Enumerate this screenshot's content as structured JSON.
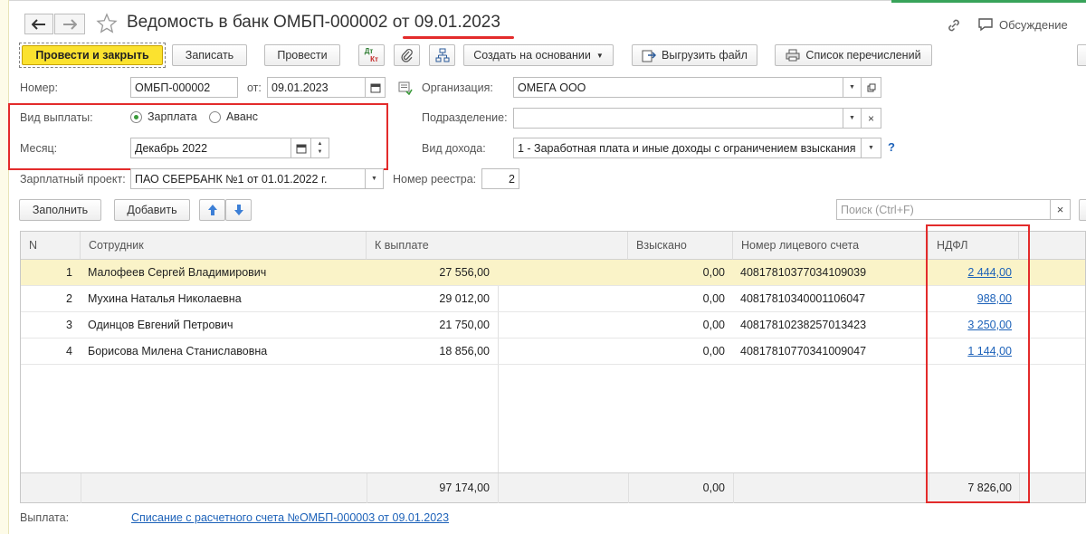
{
  "window": {
    "title_prefix": "Ведомость в банк ОМБП-000002 от ",
    "title_date": "09.01.2023",
    "discussion": "Обсуждение"
  },
  "toolbar": {
    "post_close": "Провести и закрыть",
    "save": "Записать",
    "post": "Провести",
    "dt_kt_icon_top": "Дт",
    "dt_kt_icon_bottom": "Кт",
    "create_based": "Создать на основании",
    "export_file": "Выгрузить файл",
    "transfer_list": "Список перечислений"
  },
  "form": {
    "number_label": "Номер:",
    "number_value": "ОМБП-000002",
    "from_label": "от:",
    "date_value": "09.01.2023",
    "org_label": "Организация:",
    "org_value": "ОМЕГА ООО",
    "payment_type_label": "Вид выплаты:",
    "payment_type_options": [
      "Зарплата",
      "Аванс"
    ],
    "payment_type_selected": "Зарплата",
    "division_label": "Подразделение:",
    "division_value": "",
    "month_label": "Месяц:",
    "month_value": "Декабрь 2022",
    "income_type_label": "Вид дохода:",
    "income_type_value": "1 - Заработная плата и иные доходы с ограничением взыскания",
    "help": "?",
    "salary_project_label": "Зарплатный проект:",
    "salary_project_value": "ПАО СБЕРБАНК №1 от 01.01.2022 г.",
    "registry_label": "Номер реестра:",
    "registry_value": "2"
  },
  "table_toolbar": {
    "fill": "Заполнить",
    "add": "Добавить",
    "search_placeholder": "Поиск (Ctrl+F)",
    "clear": "×"
  },
  "table": {
    "columns": [
      "N",
      "Сотрудник",
      "К выплате",
      "Взыскано",
      "Номер лицевого счета",
      "НДФЛ"
    ],
    "rows": [
      {
        "n": "1",
        "employee": "Малофеев Сергей Владимирович",
        "pay": "27 556,00",
        "recovered": "0,00",
        "account": "40817810377034109039",
        "ndfl": "2 444,00"
      },
      {
        "n": "2",
        "employee": "Мухина Наталья Николаевна",
        "pay": "29 012,00",
        "recovered": "0,00",
        "account": "40817810340001106047",
        "ndfl": "988,00"
      },
      {
        "n": "3",
        "employee": "Одинцов Евгений Петрович",
        "pay": "21 750,00",
        "recovered": "0,00",
        "account": "40817810238257013423",
        "ndfl": "3 250,00"
      },
      {
        "n": "4",
        "employee": "Борисова Милена Станиславовна",
        "pay": "18 856,00",
        "recovered": "0,00",
        "account": "40817810770341009047",
        "ndfl": "1 144,00"
      }
    ],
    "totals": {
      "pay": "97 174,00",
      "recovered": "0,00",
      "ndfl": "7 826,00"
    }
  },
  "bottom": {
    "payment_label": "Выплата:",
    "payment_link": "Списание с расчетного счета №ОМБП-000003 от 09.01.2023"
  },
  "colors": {
    "primary_button": "#fbe22f",
    "highlight_red": "#e32b2b",
    "link": "#1d62b9",
    "selected_row": "#faf3c8"
  }
}
